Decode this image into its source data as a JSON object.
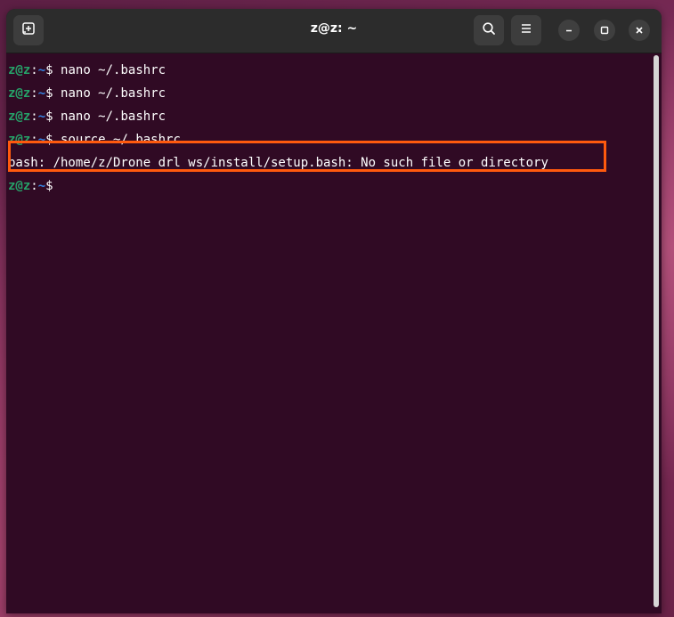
{
  "window": {
    "title": "z@z: ~"
  },
  "icons": {
    "new_tab": "new-tab-icon",
    "search": "search-icon",
    "menu": "hamburger-menu-icon",
    "minimize": "minimize-icon",
    "maximize": "maximize-icon",
    "close": "close-icon"
  },
  "colors": {
    "terminal_bg": "#300a24",
    "prompt_user": "#26a269",
    "prompt_path": "#3584e4",
    "highlight": "#ff5a0e"
  },
  "terminal": {
    "lines": [
      {
        "user": "z@z",
        "sep": ":",
        "path": "~",
        "sym": "$ ",
        "cmd": "nano ~/.bashrc"
      },
      {
        "user": "z@z",
        "sep": ":",
        "path": "~",
        "sym": "$ ",
        "cmd": "nano ~/.bashrc"
      },
      {
        "user": "z@z",
        "sep": ":",
        "path": "~",
        "sym": "$ ",
        "cmd": "nano ~/.bashrc"
      },
      {
        "user": "z@z",
        "sep": ":",
        "path": "~",
        "sym": "$ ",
        "cmd": "source ~/.bashrc"
      }
    ],
    "error": "bash: /home/z/Drone_drl_ws/install/setup.bash: No such file or directory",
    "last_prompt": {
      "user": "z@z",
      "sep": ":",
      "path": "~",
      "sym": "$"
    }
  }
}
